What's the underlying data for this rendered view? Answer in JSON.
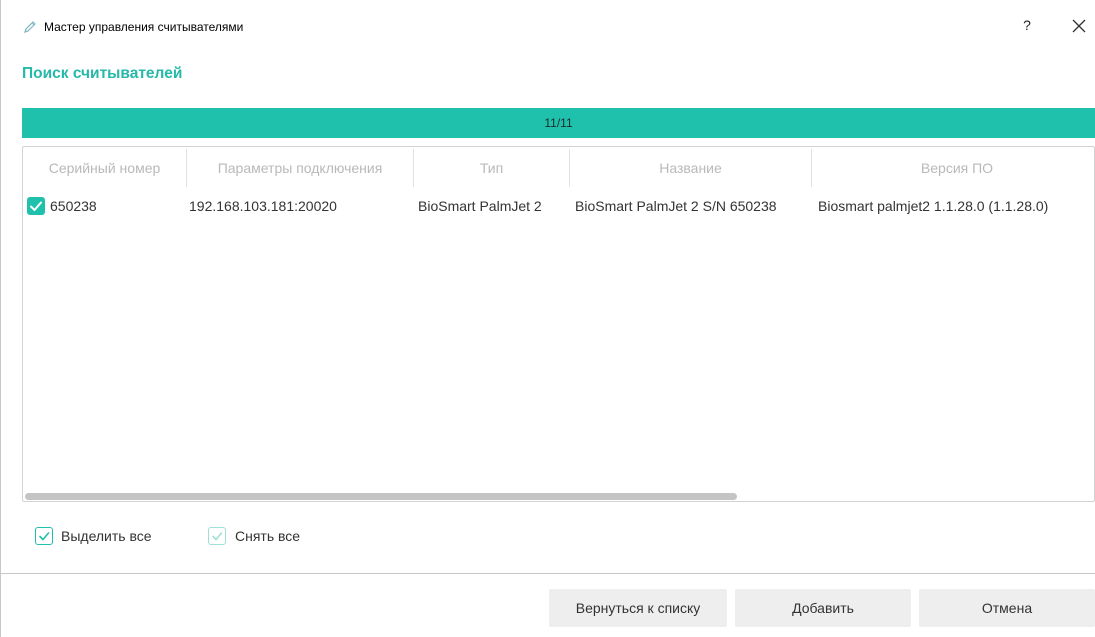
{
  "window": {
    "title": "Мастер управления считывателями",
    "help": "?"
  },
  "section_title": "Поиск считывателей",
  "progress": {
    "text": "11/11",
    "value": 1.0,
    "color": "#1fc1ad"
  },
  "table": {
    "columns": [
      "Серийный номер",
      "Параметры подключения",
      "Тип",
      "Название",
      "Версия ПО"
    ],
    "rows": [
      {
        "checked": true,
        "serial": "650238",
        "connection": "192.168.103.181:20020",
        "type": "BioSmart PalmJet 2",
        "name": "BioSmart PalmJet 2 S/N 650238",
        "version": "Biosmart palmjet2 1.1.28.0 (1.1.28.0)"
      }
    ]
  },
  "selection": {
    "select_all": "Выделить все",
    "deselect_all": "Снять все"
  },
  "buttons": {
    "back": "Вернуться к списку",
    "add": "Добавить",
    "cancel": "Отмена"
  },
  "colors": {
    "accent": "#1fc1ad",
    "heading": "#26b9a9"
  }
}
